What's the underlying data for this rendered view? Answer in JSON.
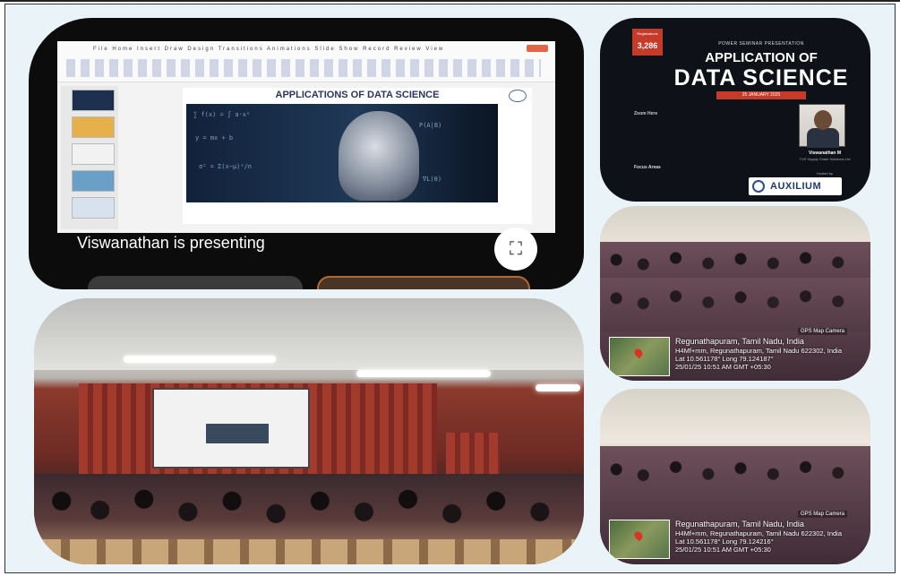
{
  "meet_panel": {
    "presenting_label": "Viswanathan is presenting",
    "fullscreen_icon": "fullscreen-icon",
    "slide_title": "APPLICATIONS OF DATA SCIENCE"
  },
  "poster": {
    "registrations": "3,286",
    "kicker": "POWER SEMINAR PRESENTATION",
    "title_line1": "APPLICATION OF",
    "title_line2": "DATA SCIENCE",
    "date": "25 JANUARY 2025",
    "zoom_label": "Zoom Here",
    "speaker_name": "Viswanathan M",
    "speaker_role": "TVS Supply Chain Solutions Ltd",
    "focus_label": "Focus Areas",
    "hosted_label": "Hosted by",
    "host_name": "AUXILIUM"
  },
  "photo_top_right": {
    "city": "Regunathapuram, Tamil Nadu, India",
    "address": "H4Mf+mm, Regunathapuram, Tamil Nadu 622302, India",
    "coords": "Lat 10.561178° Long 79.124187°",
    "timestamp": "25/01/25 10:51 AM GMT +05:30",
    "camera_label": "GPS Map Camera"
  },
  "photo_bottom_right": {
    "city": "Regunathapuram, Tamil Nadu, India",
    "address": "H4Mf+mm, Regunathapuram, Tamil Nadu 622302, India",
    "coords": "Lat 10.561178° Long 79.124216°",
    "timestamp": "25/01/25 10:51 AM GMT +05:30",
    "camera_label": "GPS Map Camera"
  }
}
